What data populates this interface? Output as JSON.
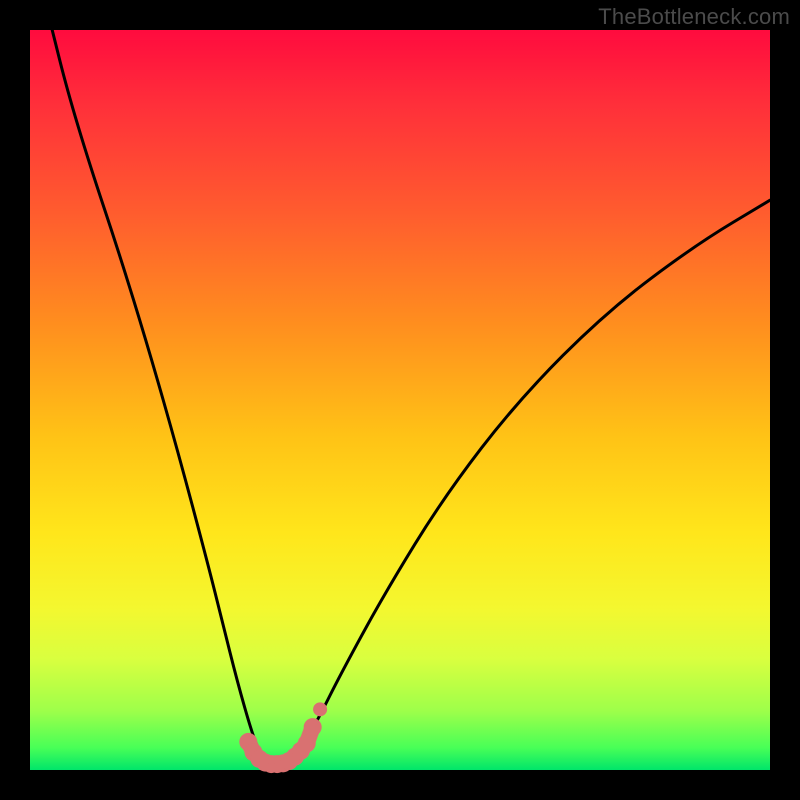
{
  "watermark": "TheBottleneck.com",
  "colors": {
    "frame": "#000000",
    "curve": "#000000",
    "markers": "#d97171",
    "gradient_top": "#ff0b3e",
    "gradient_bottom": "#00e56a"
  },
  "chart_data": {
    "type": "line",
    "title": "",
    "xlabel": "",
    "ylabel": "",
    "xlim": [
      0,
      100
    ],
    "ylim": [
      0,
      100
    ],
    "annotations": [],
    "series": [
      {
        "name": "bottleneck-curve",
        "x": [
          3,
          5,
          8,
          12,
          16,
          20,
          24,
          26,
          28,
          30,
          31,
          32,
          33,
          34,
          35,
          36,
          37,
          39,
          42,
          48,
          56,
          66,
          78,
          90,
          100
        ],
        "y": [
          100,
          92,
          82,
          70,
          57,
          43,
          28,
          20,
          12,
          5,
          2.5,
          1.3,
          0.9,
          0.9,
          1.2,
          2.0,
          3.5,
          7,
          13,
          24,
          37,
          50,
          62,
          71,
          77
        ]
      },
      {
        "name": "bottom-markers",
        "x": [
          29.5,
          30.2,
          31.0,
          31.8,
          32.6,
          33.4,
          34.2,
          35.0,
          35.8,
          36.6,
          37.4,
          38.2
        ],
        "y": [
          3.8,
          2.4,
          1.5,
          1.0,
          0.8,
          0.8,
          0.9,
          1.2,
          1.8,
          2.6,
          3.6,
          5.8
        ]
      }
    ]
  }
}
